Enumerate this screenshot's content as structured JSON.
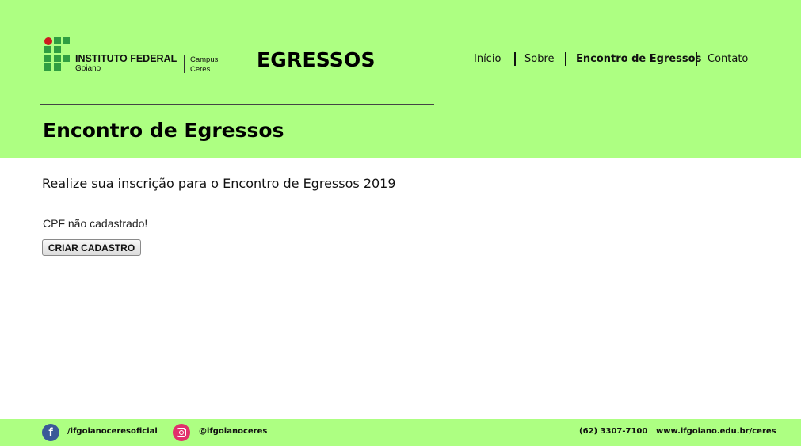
{
  "header": {
    "logo": {
      "title": "INSTITUTO FEDERAL",
      "subtitle": "Goiano",
      "campus_line1": "Campus",
      "campus_line2": "Ceres"
    },
    "brand": "EGRESSOS",
    "nav": [
      {
        "label": "Início"
      },
      {
        "label": "Sobre"
      },
      {
        "label": "Encontro de Egressos",
        "active": true
      },
      {
        "label": "Contato"
      }
    ],
    "page_title": "Encontro de Egressos"
  },
  "main": {
    "intro": "Realize sua inscrição para o Encontro de Egressos 2019",
    "status": "CPF não cadastrado!",
    "create_button": "CRIAR CADASTRO"
  },
  "footer": {
    "facebook": "/ifgoianoceresoficial",
    "instagram": "@ifgoianoceres",
    "phone": "(62) 3307-7100",
    "website": "www.ifgoiano.edu.br/ceres"
  },
  "colors": {
    "header_bg": "#adff82",
    "logo_green": "#2f9e41",
    "logo_red": "#cd191e"
  },
  "icons": [
    "facebook-icon",
    "instagram-icon"
  ]
}
